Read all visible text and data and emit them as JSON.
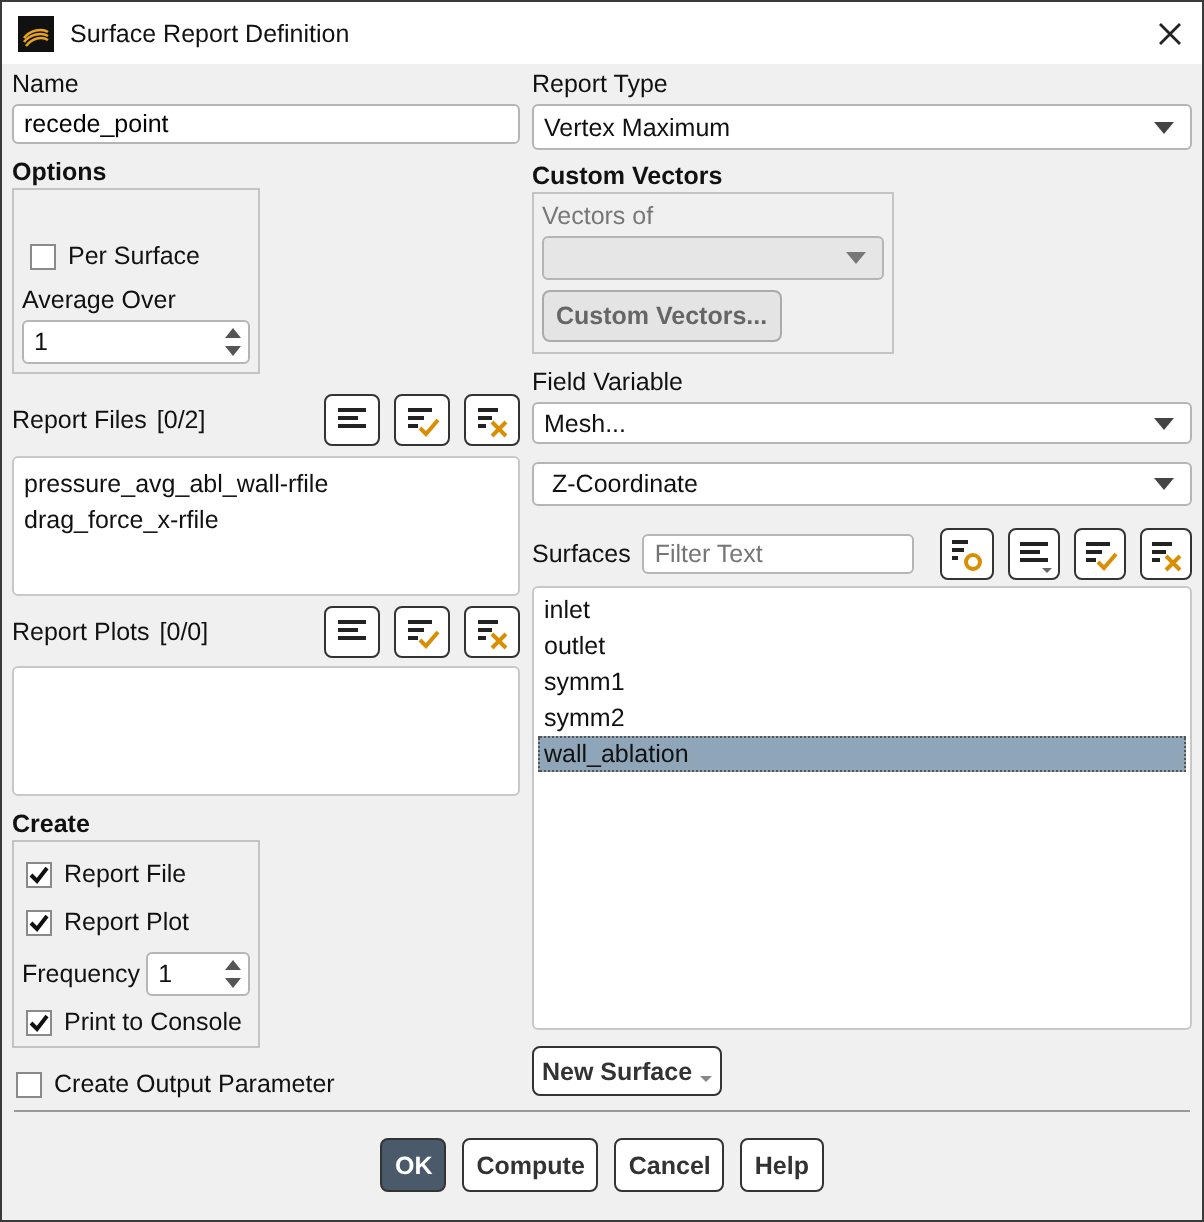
{
  "window": {
    "title": "Surface Report Definition"
  },
  "name": {
    "label": "Name",
    "value": "recede_point"
  },
  "options": {
    "title": "Options",
    "per_surface": {
      "label": "Per Surface",
      "checked": false
    },
    "average_over": {
      "label": "Average Over",
      "value": "1"
    }
  },
  "report_files": {
    "label": "Report Files",
    "count": "[0/2]",
    "items": [
      "pressure_avg_abl_wall-rfile",
      "drag_force_x-rfile"
    ]
  },
  "report_plots": {
    "label": "Report Plots",
    "count": "[0/0]"
  },
  "create": {
    "title": "Create",
    "items": [
      {
        "kind": "checkbox",
        "label": "Report File",
        "checked": true
      },
      {
        "kind": "checkbox",
        "label": "Report Plot",
        "checked": true
      },
      {
        "kind": "spinner",
        "label": "Frequency",
        "value": "1"
      },
      {
        "kind": "checkbox",
        "label": "Print to Console",
        "checked": true
      }
    ]
  },
  "create_output_parameter": {
    "label": "Create Output Parameter",
    "checked": false
  },
  "report_type": {
    "label": "Report Type",
    "value": "Vertex Maximum"
  },
  "custom_vectors": {
    "title": "Custom Vectors",
    "vectors_of": {
      "label": "Vectors of",
      "disabled": true
    },
    "button": {
      "label": "Custom Vectors...",
      "disabled": true
    }
  },
  "field_variable": {
    "label": "Field Variable",
    "category": "Mesh...",
    "variable": "Z-Coordinate"
  },
  "surfaces": {
    "label": "Surfaces",
    "filter": {
      "placeholder": "Filter Text"
    },
    "items": [
      {
        "label": "inlet",
        "selected": false
      },
      {
        "label": "outlet",
        "selected": false
      },
      {
        "label": "symm1",
        "selected": false
      },
      {
        "label": "symm2",
        "selected": false
      },
      {
        "label": "wall_ablation",
        "selected": true
      }
    ]
  },
  "new_surface_button": {
    "label": "New Surface"
  },
  "buttons": [
    {
      "label": "OK",
      "default": true
    },
    {
      "label": "Compute",
      "default": false
    },
    {
      "label": "Cancel",
      "default": false
    },
    {
      "label": "Help",
      "default": false
    }
  ]
}
